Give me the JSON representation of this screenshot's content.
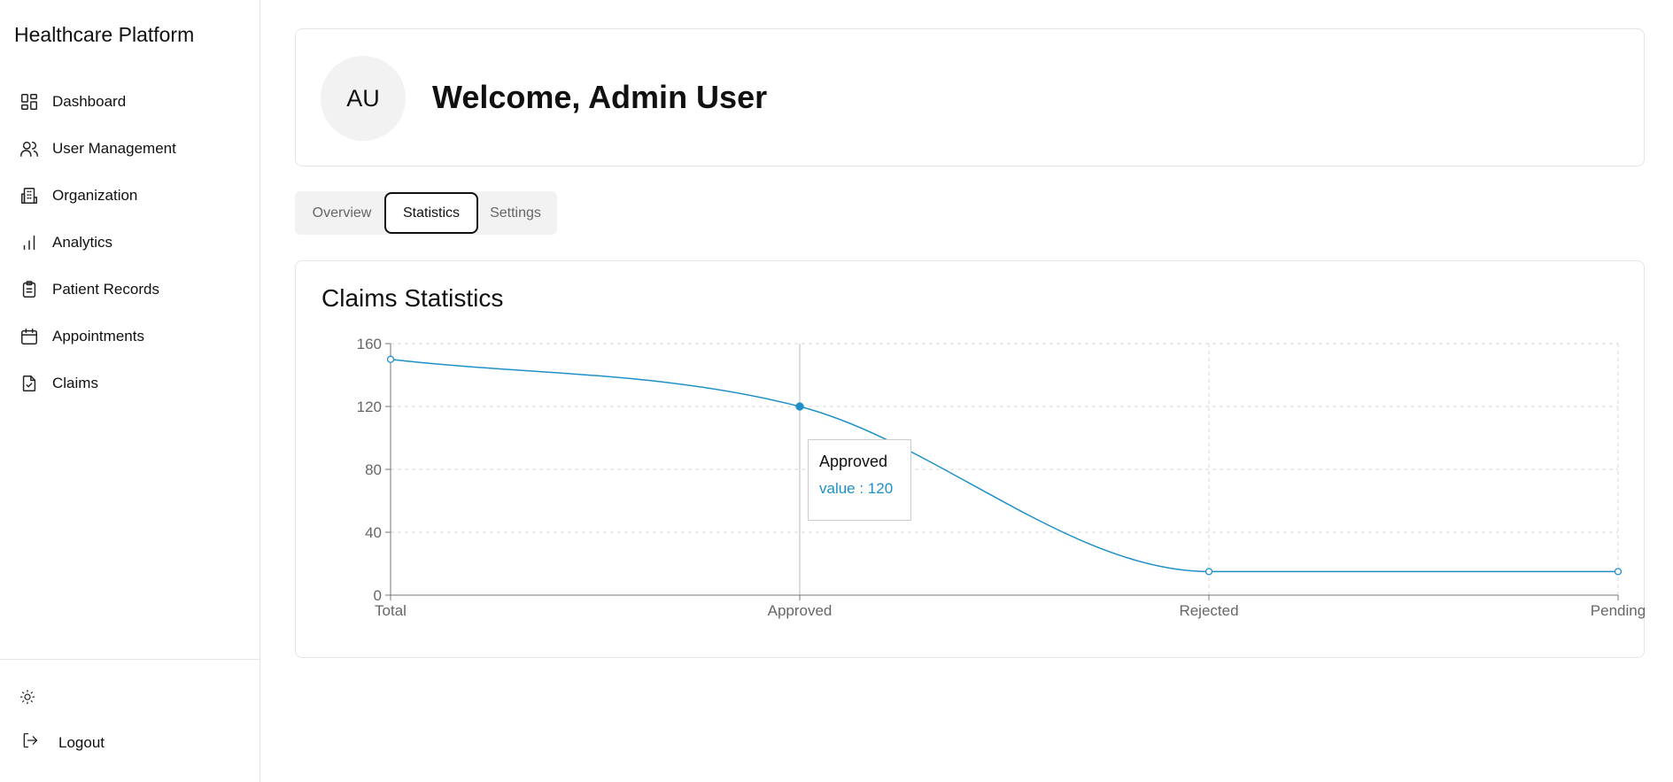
{
  "app": {
    "title": "Healthcare Platform"
  },
  "sidebar": {
    "items": [
      {
        "label": "Dashboard",
        "icon": "dashboard-icon"
      },
      {
        "label": "User Management",
        "icon": "users-icon"
      },
      {
        "label": "Organization",
        "icon": "building-icon"
      },
      {
        "label": "Analytics",
        "icon": "bar-chart-icon"
      },
      {
        "label": "Patient Records",
        "icon": "clipboard-icon"
      },
      {
        "label": "Appointments",
        "icon": "calendar-icon"
      },
      {
        "label": "Claims",
        "icon": "file-check-icon"
      }
    ],
    "theme_icon": "sun-icon",
    "logout_label": "Logout",
    "logout_icon": "logout-icon"
  },
  "header": {
    "avatar_initials": "AU",
    "welcome": "Welcome, Admin User"
  },
  "tabs": {
    "items": [
      {
        "label": "Overview"
      },
      {
        "label": "Statistics"
      },
      {
        "label": "Settings"
      }
    ],
    "active": "Statistics"
  },
  "chart": {
    "title": "Claims Statistics",
    "tooltip": {
      "label": "Approved",
      "value_text": "value : 120"
    }
  },
  "chart_data": {
    "type": "line",
    "categories": [
      "Total",
      "Approved",
      "Rejected",
      "Pending"
    ],
    "values": [
      150,
      120,
      15,
      15
    ],
    "ylim": [
      0,
      160
    ],
    "yticks": [
      0,
      40,
      80,
      120,
      160
    ],
    "grid": true,
    "line_color": "#1e90c8",
    "active_index": 1
  }
}
